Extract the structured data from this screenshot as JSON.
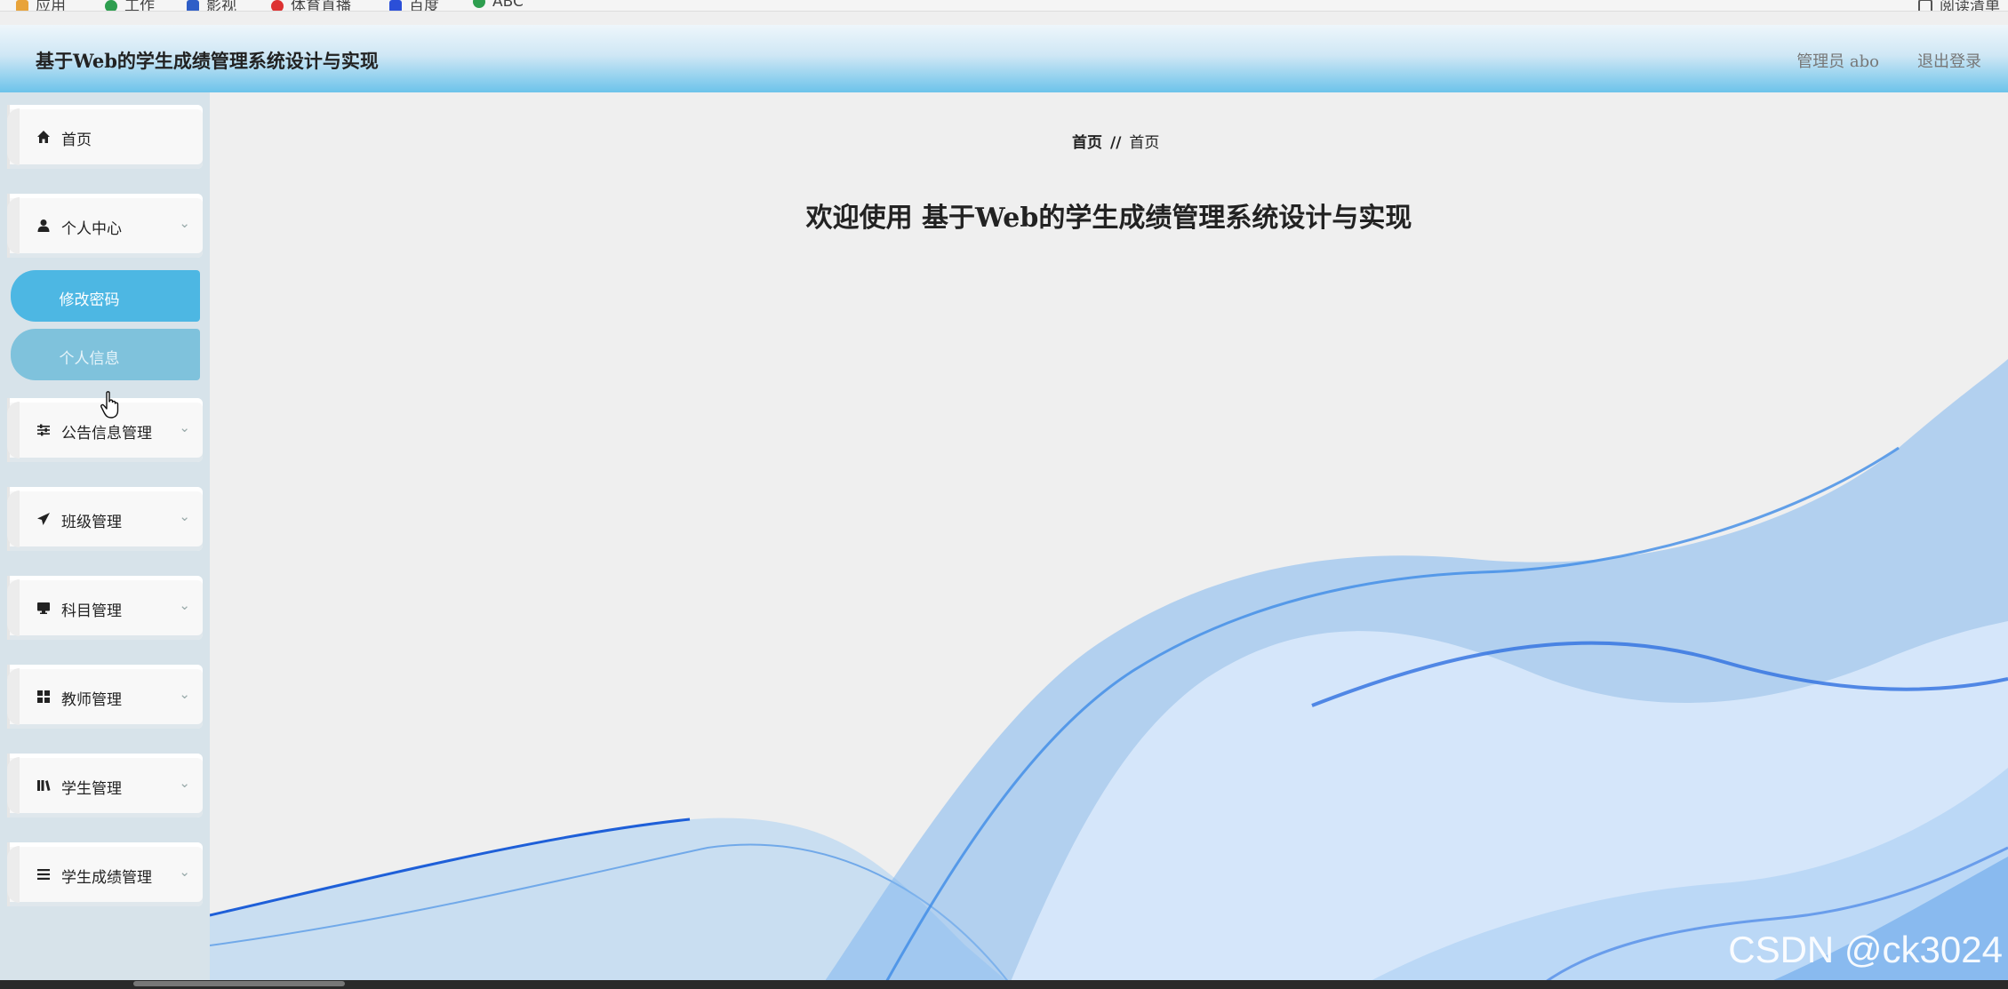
{
  "browser": {
    "bookmarks": [
      "应用",
      "工作",
      "影视",
      "体育直播",
      "百度",
      "ABC"
    ],
    "right_label": "阅读清单"
  },
  "header": {
    "title": "基于Web的学生成绩管理系统设计与实现",
    "user_text": "管理员 abo",
    "logout_label": "退出登录"
  },
  "sidebar": {
    "items": [
      {
        "label": "首页",
        "icon": "home-icon"
      },
      {
        "label": "个人中心",
        "icon": "user-icon",
        "expanded": true,
        "children": [
          {
            "label": "修改密码",
            "active": true
          },
          {
            "label": "个人信息"
          }
        ]
      },
      {
        "label": "公告信息管理",
        "icon": "sliders-icon"
      },
      {
        "label": "班级管理",
        "icon": "send-icon"
      },
      {
        "label": "科目管理",
        "icon": "monitor-icon"
      },
      {
        "label": "教师管理",
        "icon": "grid-icon"
      },
      {
        "label": "学生管理",
        "icon": "book-icon"
      },
      {
        "label": "学生成绩管理",
        "icon": "list-icon"
      }
    ]
  },
  "main": {
    "breadcrumb": {
      "home": "首页",
      "separator": "//",
      "current": "首页"
    },
    "welcome": "欢迎使用 基于Web的学生成绩管理系统设计与实现"
  },
  "watermark": "CSDN @ck3024",
  "colors": {
    "accent": "#4db7e3",
    "sub_item": "#7fc2dc",
    "sidebar_bg": "#d7e3ea",
    "wave": "#3f8fe0"
  }
}
